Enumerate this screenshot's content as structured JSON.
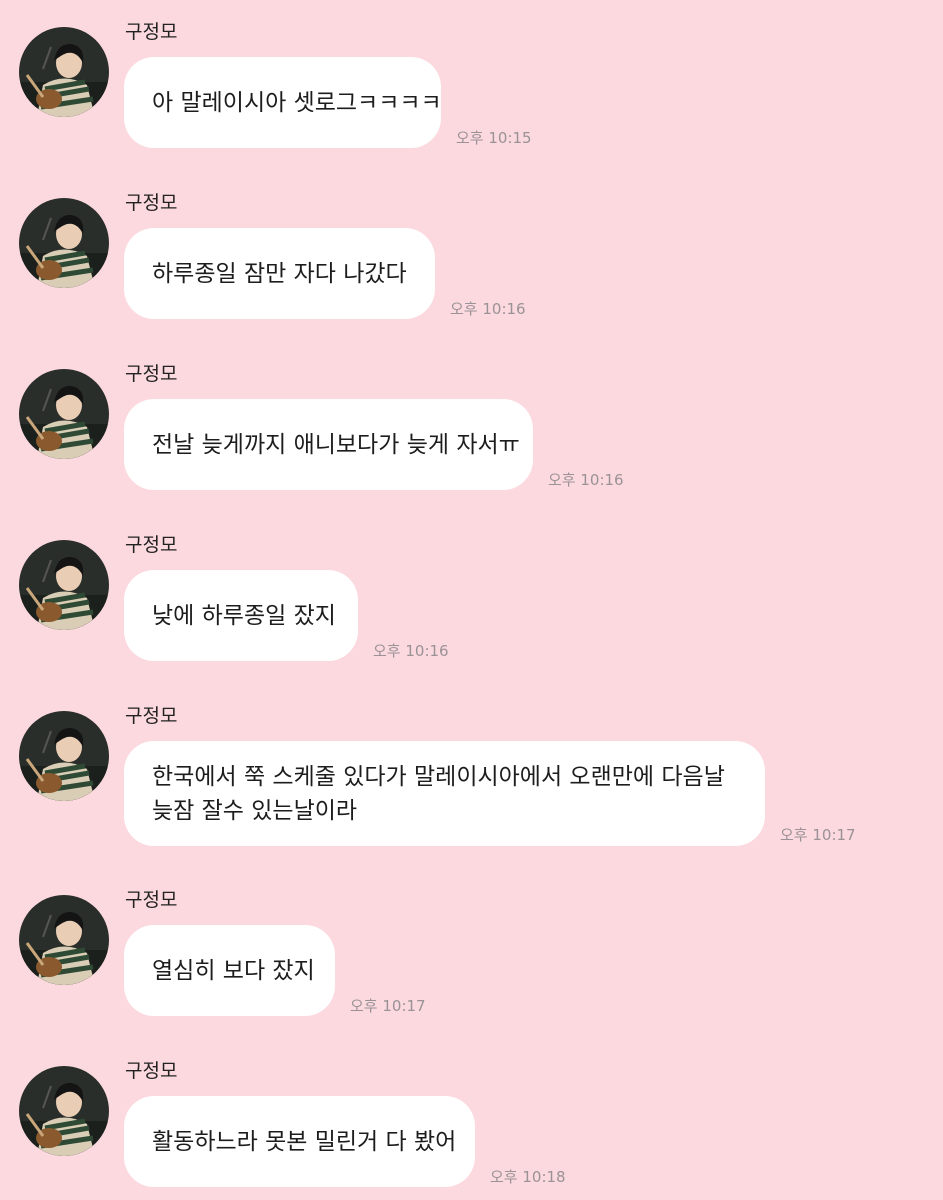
{
  "chat": {
    "messages": [
      {
        "sender": "구정모",
        "lines": [
          "아 말레이시아 셋로그ㅋㅋㅋㅋ"
        ],
        "time": "오후 10:15"
      },
      {
        "sender": "구정모",
        "lines": [
          "하루종일 잠만 자다 나갔다"
        ],
        "time": "오후 10:16"
      },
      {
        "sender": "구정모",
        "lines": [
          "전날 늦게까지 애니보다가 늦게 자서ㅠ"
        ],
        "time": "오후 10:16"
      },
      {
        "sender": "구정모",
        "lines": [
          "낮에 하루종일 잤지"
        ],
        "time": "오후 10:16"
      },
      {
        "sender": "구정모",
        "lines": [
          "한국에서 쭉 스케줄 있다가 말레이시아에서 오랜만에 다음날",
          "늦잠 잘수 있는날이라"
        ],
        "time": "오후 10:17"
      },
      {
        "sender": "구정모",
        "lines": [
          "열심히 보다 잤지"
        ],
        "time": "오후 10:17"
      },
      {
        "sender": "구정모",
        "lines": [
          "활동하느라 못본 밀린거 다 봤어"
        ],
        "time": "오후 10:18"
      }
    ]
  },
  "avatar_icon": "profile-photo-icon",
  "colors": {
    "background": "#fbd9df",
    "bubble": "#ffffff",
    "text": "#1d1d1d",
    "time": "#9a9296"
  }
}
